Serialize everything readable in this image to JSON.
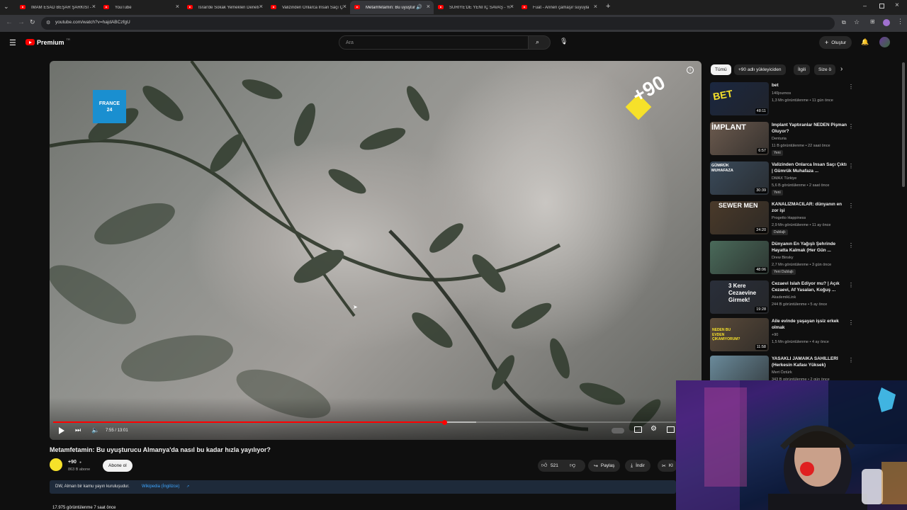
{
  "browser": {
    "tabs": [
      {
        "label": "İMAM ESAD BEŞAR ŞARKISI - Yo",
        "active": false
      },
      {
        "label": "YouTube",
        "active": false
      },
      {
        "label": "İsrail'de Sokak Yemekleri Deneti",
        "active": false
      },
      {
        "label": "Valizinden Onlarca İnsan Saçı Ç",
        "active": false
      },
      {
        "label": "Metamfetamin: Bu uyuştur",
        "active": true
      },
      {
        "label": "SURİYE'DE YENİ İÇ SAVAŞ - You",
        "active": false
      },
      {
        "label": "Fuat - Annen çamaşır suyuyla",
        "active": false
      }
    ],
    "url": "youtube.com/watch?v=hajdABCzfgU"
  },
  "youtube": {
    "logo_text": "Premium",
    "logo_sup": "TR",
    "search_placeholder": "Ara",
    "create_label": "Oluştur"
  },
  "player": {
    "time": "7:55 / 13:01",
    "progress_fraction": 0.607,
    "buffered_fraction": 0.656,
    "overlay_logo_left": "FRANCE 24",
    "overlay_logo_right": "+90"
  },
  "video_info": {
    "title": "Metamfetamin: Bu uyuşturucu Almanya'da nasıl bu kadar hızla yayılıyor?",
    "channel": "+90",
    "subscribers": "863 B abone",
    "subscribe_label": "Abone ol",
    "likes": "521",
    "share_label": "Paylaş",
    "download_label": "İndir",
    "clip_label": "Kl",
    "info_text": "DW, Alman bir kamu yayın kuruluşudur.",
    "info_link": "Wikipedia (İngilizce)",
    "views_partial": "17.975 görüntülenme  7 saat önce"
  },
  "chips": [
    {
      "label": "Tümü",
      "active": true
    },
    {
      "label": "+90 adlı yükleyiciden",
      "active": false
    },
    {
      "label": "İlgili",
      "active": false
    },
    {
      "label": "Size ö",
      "active": false
    }
  ],
  "recommendations": [
    {
      "title": "bet",
      "channel": "140journos",
      "meta": "1,3 Mn görüntülenme • 11 gün önce",
      "duration": "48:11",
      "badge": "",
      "thumb_color": "#1b2740"
    },
    {
      "title": "İmplant Yaptıranlar NEDEN Pişman Oluyor?",
      "channel": "Denturia",
      "meta": "11 B görüntülenme • 22 saat önce",
      "duration": "6:57",
      "badge": "Yeni",
      "thumb_color": "#6b5a4e"
    },
    {
      "title": "Valizinden Onlarca İnsan Saçı Çıktı | Gümrük Muhafaza ...",
      "channel": "DMAX Türkiye",
      "meta": "5,6 B görüntülenme • 2 saat önce",
      "duration": "30:39",
      "badge": "Yeni",
      "thumb_color": "#3a4a5a"
    },
    {
      "title": "KANALİZMACILAR: dünyanın en zor işi",
      "channel": "Progetto Happiness",
      "meta": "2,9 Mn görüntülenme • 11 ay önce",
      "duration": "24:20",
      "badge": "Dublajlı",
      "thumb_color": "#4a3a2a"
    },
    {
      "title": "Dünyanın En Yağışlı Şehrinde Hayatta Kalmak (Her Gün ...",
      "channel": "Drew Binsky",
      "meta": "2,7 Mn görüntülenme • 3 gün önce",
      "duration": "48:06",
      "badge": "Yeni  Dublajlı",
      "thumb_color": "#4a6a5a"
    },
    {
      "title": "Cezaevi Islah Ediyor mu? | Açık Cezaevi, Af Yasaları, Koğuş ...",
      "channel": "AkademikLink",
      "meta": "244 B görüntülenme • 5 ay önce",
      "duration": "19:28",
      "badge": "",
      "thumb_color": "#2a2f3a"
    },
    {
      "title": "Aile evinde yaşayan işsiz erkek olmak",
      "channel": "+90",
      "meta": "1,5 Mn görüntülenme • 4 ay önce",
      "duration": "11:58",
      "badge": "",
      "thumb_color": "#5a4a3a"
    },
    {
      "title": "YASAKLI JAMAIKA SAHİLLERİ (Herkesin Kafası Yüksek)",
      "channel": "Mert Öztürk",
      "meta": "343 B görüntülenme • 2 gün önce",
      "duration": "",
      "badge": "",
      "thumb_color": "#6a8a9a"
    }
  ],
  "thumb_texts": {
    "r0": "BET",
    "r1": "İMPLANT",
    "r2": "GÜMRÜK MUHAFAZA",
    "r3": "SEWER MEN",
    "r5": "3 Kere Cezaevine Girmek!",
    "r6": "NEDEN BU EVDEN ÇIKAMIYORUM?"
  },
  "colors": {
    "accent": "#ff0000",
    "background": "#0f0f0f"
  }
}
